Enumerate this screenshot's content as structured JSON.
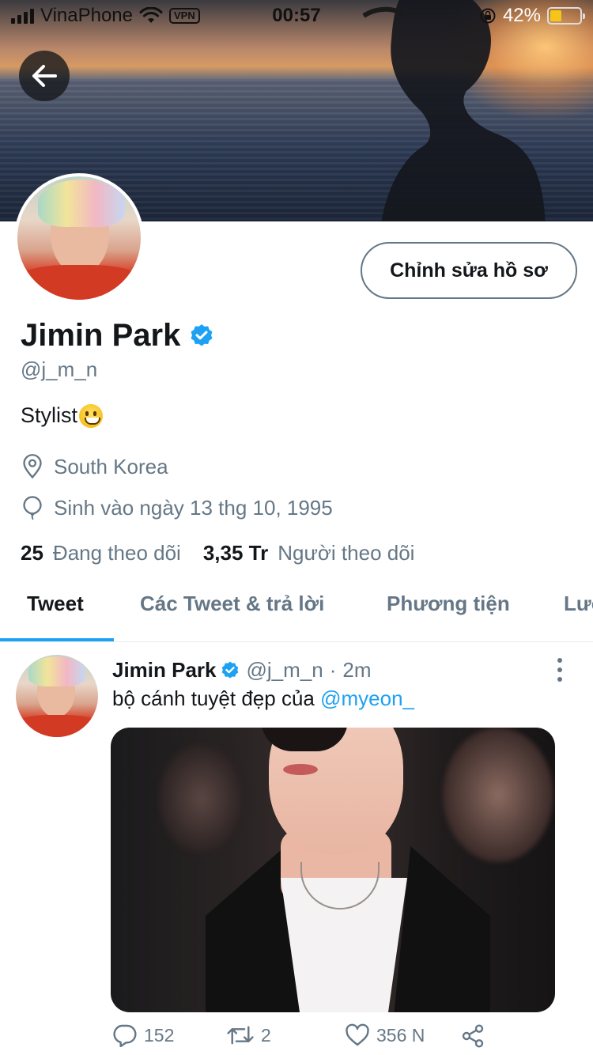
{
  "status_bar": {
    "carrier": "VinaPhone",
    "vpn": "VPN",
    "time": "00:57",
    "battery": "42%",
    "battery_level": 0.42
  },
  "profile": {
    "edit_button": "Chỉnh sửa hồ sơ",
    "name": "Jimin Park",
    "handle": "@j_m_n",
    "bio": "Stylist",
    "location": "South Korea",
    "birthday": "Sinh vào ngày 13 thg 10, 1995",
    "following_count": "25",
    "following_label": "Đang theo dõi",
    "followers_count": "3,35 Tr",
    "followers_label": "Người theo dõi"
  },
  "tabs": [
    {
      "label": "Tweet"
    },
    {
      "label": "Các Tweet & trả lời"
    },
    {
      "label": "Phương tiện"
    },
    {
      "label": "Lượt thích"
    }
  ],
  "tweet": {
    "name": "Jimin Park",
    "handle": "@j_m_n",
    "separator": "·",
    "time": "2m",
    "text": "bộ cánh tuyệt đẹp của",
    "mention": "@myeon_",
    "replies": "152",
    "retweets": "2",
    "likes": "356 N"
  },
  "colors": {
    "accent": "#1da1f2",
    "secondary_text": "#657786",
    "primary_text": "#14171a",
    "verified": "#1da1f2"
  },
  "icons": [
    "back-arrow-icon",
    "verified-badge-icon",
    "location-pin-icon",
    "balloon-icon",
    "more-icon",
    "reply-icon",
    "retweet-icon",
    "like-icon",
    "share-icon",
    "wifi-icon",
    "signal-icon",
    "rotation-lock-icon",
    "battery-icon"
  ]
}
